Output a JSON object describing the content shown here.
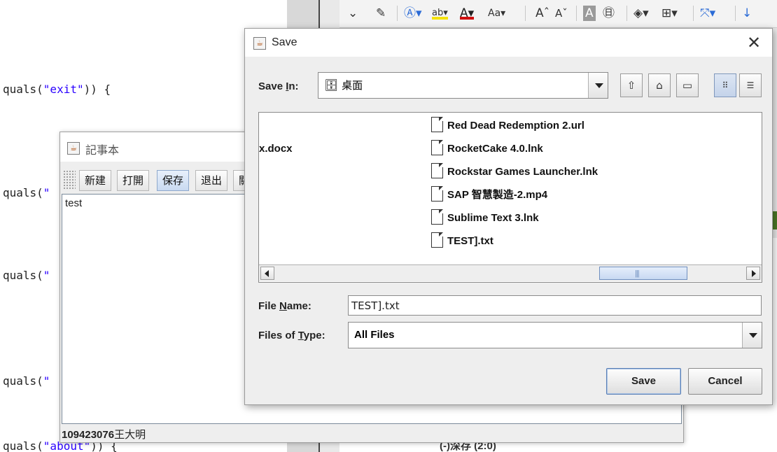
{
  "code_editor": {
    "lines": [
      {
        "prefix": "quals(",
        "str": "\"exit\"",
        "suffix": ")) {"
      },
      {
        "prefix": "quals(",
        "str": "\"",
        "suffix": ""
      },
      {
        "prefix": "quals(",
        "str": "\"",
        "suffix": ""
      },
      {
        "prefix": "quals(",
        "str": "\"",
        "suffix": ""
      },
      {
        "prefix": "quals(",
        "str": "\"about\"",
        "suffix": ")) {"
      }
    ]
  },
  "ribbon": {
    "bottom_fragment": "(-)深存 (2:0)"
  },
  "notepad": {
    "title": "記事本",
    "toolbar": {
      "new_label": "新建",
      "open_label": "打開",
      "save_label": "保存",
      "exit_label": "退出",
      "more_label": "關"
    },
    "text_content": "test",
    "status": {
      "id": "109423076",
      "name": "王大明"
    }
  },
  "save_dialog": {
    "title": "Save",
    "save_in_label": "Save In:",
    "save_in_accel": "I",
    "save_in_value": "桌面",
    "file_list": {
      "col1": [
        "x.docx"
      ],
      "col2": [
        "Red Dead Redemption 2.url",
        "RocketCake 4.0.lnk",
        "Rockstar Games Launcher.lnk",
        "SAP 智慧製造-2.mp4",
        "Sublime Text 3.lnk",
        "TEST].txt"
      ]
    },
    "file_name_label": "File Name:",
    "file_name_accel": "N",
    "file_name_value": "TEST].txt",
    "files_of_type_label": "Files of Type:",
    "files_of_type_accel": "T",
    "files_of_type_value": "All Files",
    "save_button": "Save",
    "cancel_button": "Cancel"
  }
}
